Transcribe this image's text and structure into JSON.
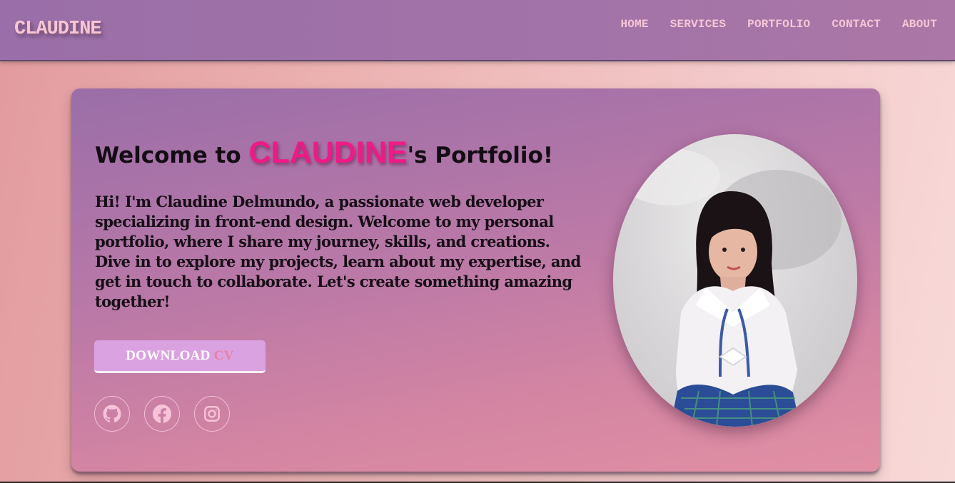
{
  "logo": "CLAUDINE",
  "nav": {
    "items": [
      {
        "label": "HOME"
      },
      {
        "label": "SERVICES"
      },
      {
        "label": "PORTFOLIO"
      },
      {
        "label": "CONTACT"
      },
      {
        "label": "ABOUT"
      }
    ]
  },
  "hero": {
    "title_prefix": "Welcome to ",
    "title_highlight": "CLAUDINE",
    "title_suffix": "'s Portfolio!",
    "intro": "Hi! I'm Claudine Delmundo, a passionate web developer specializing in front-end design. Welcome to my personal portfolio, where I share my journey, skills, and creations. Dive in to explore my projects, learn about my expertise, and get in touch to collaborate. Let's create something amazing together!",
    "cv_button": {
      "text": "DOWNLOAD ",
      "accent": "CV"
    },
    "socials": [
      {
        "icon": "github-icon"
      },
      {
        "icon": "facebook-icon"
      },
      {
        "icon": "instagram-icon"
      }
    ]
  },
  "colors": {
    "nav_bg": "#a273a8",
    "nav_text": "#f6c6d6",
    "title_highlight": "#ef1a87",
    "button_bg": "#dba2e2",
    "button_accent": "#e681a7"
  }
}
